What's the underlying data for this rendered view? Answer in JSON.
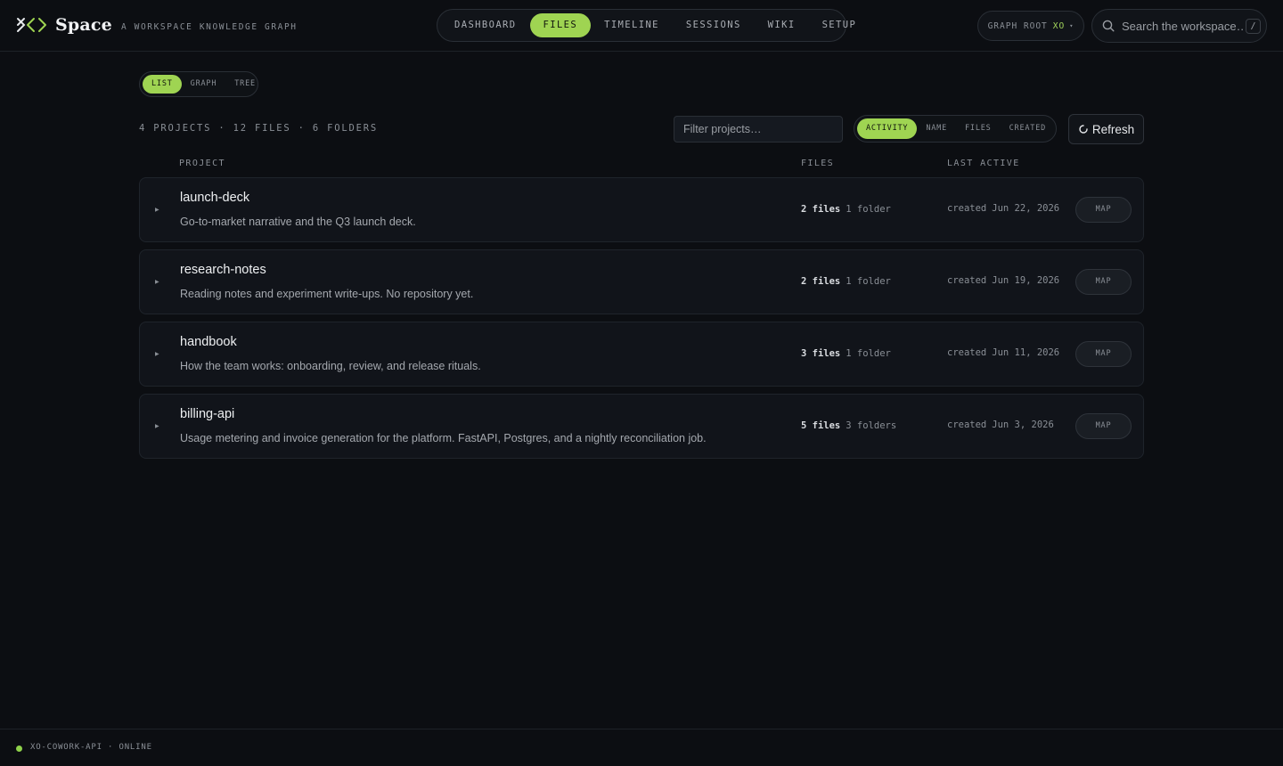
{
  "brand": {
    "name": "Space",
    "tagline": "A WORKSPACE KNOWLEDGE GRAPH"
  },
  "nav": {
    "items": [
      {
        "label": "DASHBOARD",
        "active": false
      },
      {
        "label": "FILES",
        "active": true
      },
      {
        "label": "TIMELINE",
        "active": false
      },
      {
        "label": "SESSIONS",
        "active": false
      },
      {
        "label": "WIKI",
        "active": false
      },
      {
        "label": "SETUP",
        "active": false
      }
    ]
  },
  "graph_root": {
    "label": "GRAPH ROOT",
    "value": "XO"
  },
  "search": {
    "placeholder": "Search the workspace…",
    "shortcut": "/"
  },
  "view_toggle": {
    "items": [
      "LIST",
      "GRAPH",
      "TREE"
    ],
    "selected": "LIST"
  },
  "summary": "4 PROJECTS · 12 FILES · 6 FOLDERS",
  "filter": {
    "placeholder": "Filter projects…"
  },
  "sort": {
    "items": [
      "ACTIVITY",
      "NAME",
      "FILES",
      "CREATED"
    ],
    "selected": "ACTIVITY"
  },
  "refresh_label": "Refresh",
  "columns": {
    "project": "PROJECT",
    "files": "FILES",
    "last_active": "LAST ACTIVE"
  },
  "projects": [
    {
      "name": "launch-deck",
      "description": "Go-to-market narrative and the Q3 launch deck.",
      "files": "2 files",
      "folders": "1 folder",
      "created_label": "created",
      "created_date": "Jun 22, 2026",
      "action": "MAP"
    },
    {
      "name": "research-notes",
      "description": "Reading notes and experiment write-ups. No repository yet.",
      "files": "2 files",
      "folders": "1 folder",
      "created_label": "created",
      "created_date": "Jun 19, 2026",
      "action": "MAP"
    },
    {
      "name": "handbook",
      "description": "How the team works: onboarding, review, and release rituals.",
      "files": "3 files",
      "folders": "1 folder",
      "created_label": "created",
      "created_date": "Jun 11, 2026",
      "action": "MAP"
    },
    {
      "name": "billing-api",
      "description": "Usage metering and invoice generation for the platform. FastAPI, Postgres, and a nightly reconciliation job.",
      "files": "5 files",
      "folders": "3 folders",
      "created_label": "created",
      "created_date": "Jun 3, 2026",
      "action": "MAP"
    }
  ],
  "footer": {
    "status": "XO-COWORK-API · ONLINE",
    "status_color": "#8ed14a"
  },
  "colors": {
    "accent": "#9fd452",
    "background": "#0c0e12"
  }
}
